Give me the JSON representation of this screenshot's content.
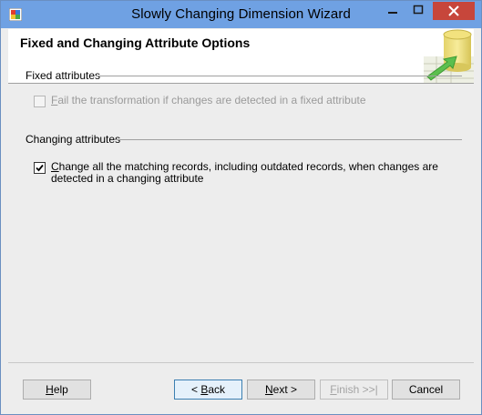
{
  "window": {
    "title": "Slowly Changing Dimension Wizard",
    "icon": "wizard-app-icon",
    "controls": [
      "minimize-icon",
      "maximize-icon",
      "close-icon"
    ],
    "close_color": "#c7463b",
    "titlebar_color": "#6fa1e3"
  },
  "header": {
    "title": "Fixed and Changing Attribute Options",
    "graphic": "database-cylinder-icon"
  },
  "fixed_attributes": {
    "group_label": "Fixed attributes",
    "checkbox": {
      "label_pre": "",
      "label_accel": "F",
      "label_post": "ail the transformation if changes are detected in a fixed attribute",
      "checked": false,
      "enabled": false
    }
  },
  "changing_attributes": {
    "group_label": "Changing attributes",
    "checkbox": {
      "label_pre": "",
      "label_accel": "C",
      "label_post": "hange all the matching records, including outdated records, when changes are detected in a changing attribute",
      "checked": true,
      "enabled": true
    }
  },
  "buttons": {
    "help": {
      "pre": "",
      "accel": "H",
      "post": "elp"
    },
    "back": {
      "pre": "< ",
      "accel": "B",
      "post": "ack"
    },
    "next": {
      "pre": "",
      "accel": "N",
      "post": "ext >"
    },
    "finish": {
      "pre": "",
      "accel": "F",
      "post": "inish >>|"
    },
    "cancel": {
      "pre": "Cancel",
      "accel": "",
      "post": ""
    }
  }
}
